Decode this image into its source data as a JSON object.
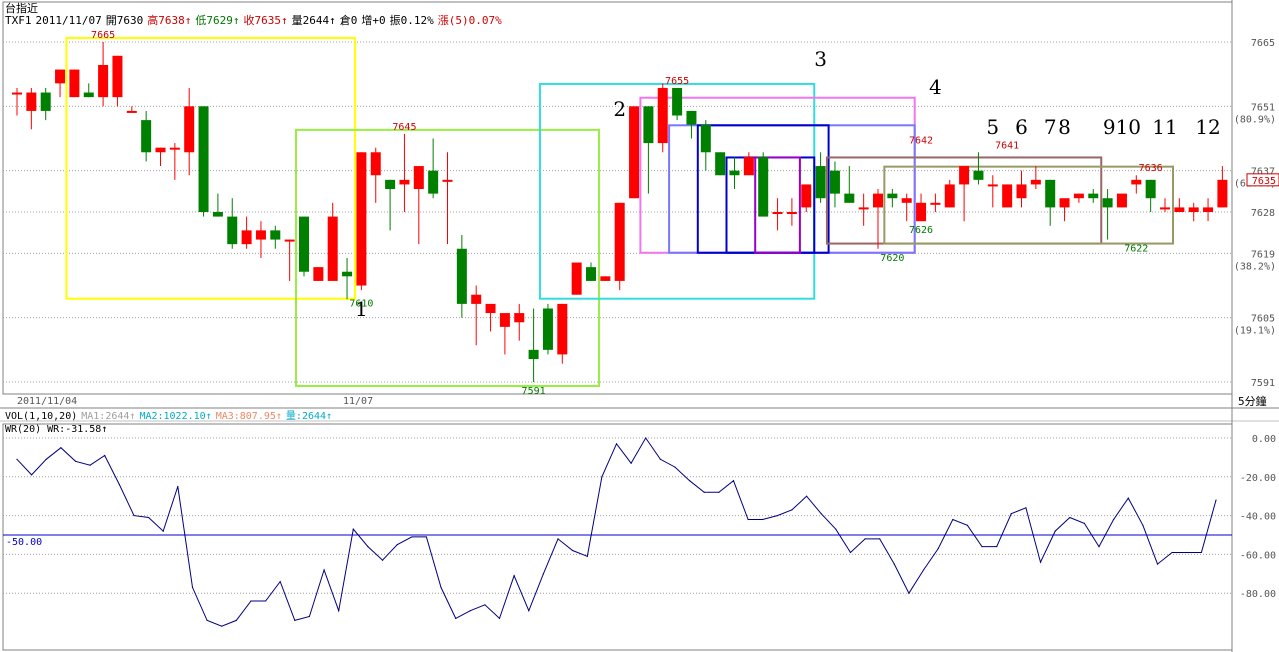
{
  "header": {
    "title": "台指近",
    "symbol": "TXF1",
    "date": "2011/11/07",
    "open": "開7630",
    "high": "高7638↑",
    "low": "低7629↑",
    "close": "收7635↑",
    "volume": "量2644↑",
    "position": "倉0",
    "change": "增+0",
    "amplitude": "振0.12%",
    "rise5": "漲(5)0.07%"
  },
  "vol_header": {
    "label": "VOL(1,10,20)",
    "ma1": "MA1:2644↑",
    "ma2": "MA2:1022.10↑",
    "ma3": "MA3:807.95↑",
    "qty": "量:2644↑"
  },
  "wr_header": "WR(20) WR:-31.58↑",
  "timeframe": "5分鐘",
  "date_labels": [
    "2011/11/04",
    "11/07"
  ],
  "colors": {
    "up": "#ff0000",
    "down": "#008000",
    "wr_line": "#00007f",
    "grid": "#a0a0a0"
  },
  "chart_data": [
    {
      "type": "candlestick",
      "title": "台指近 TXF1",
      "ylim": [
        7584,
        7672
      ],
      "y_ticks": [
        7591,
        7605,
        7619,
        7628,
        7637,
        7651,
        7665
      ],
      "y_tick_pct": [
        {
          "value": 7605,
          "label": "(19.1%)"
        },
        {
          "value": 7619,
          "label": "(38.2%)"
        },
        {
          "value": 7637,
          "label": "(61.8%)"
        },
        {
          "value": 7651,
          "label": "(80.9%)"
        }
      ],
      "last_price": 7635,
      "candles": [
        {
          "o": 7654,
          "h": 7655,
          "l": 7649,
          "c": 7654
        },
        {
          "o": 7650,
          "h": 7655,
          "l": 7646,
          "c": 7654
        },
        {
          "o": 7654,
          "h": 7655,
          "l": 7648,
          "c": 7650
        },
        {
          "o": 7656,
          "h": 7659,
          "l": 7653,
          "c": 7659
        },
        {
          "o": 7653,
          "h": 7659,
          "l": 7653,
          "c": 7659
        },
        {
          "o": 7654,
          "h": 7656,
          "l": 7653,
          "c": 7653
        },
        {
          "o": 7653,
          "h": 7665,
          "l": 7651,
          "c": 7660
        },
        {
          "o": 7653,
          "h": 7662,
          "l": 7651,
          "c": 7662
        },
        {
          "o": 7650,
          "h": 7651,
          "l": 7650,
          "c": 7650
        },
        {
          "o": 7648,
          "h": 7650,
          "l": 7639,
          "c": 7641
        },
        {
          "o": 7641,
          "h": 7642,
          "l": 7638,
          "c": 7642
        },
        {
          "o": 7642,
          "h": 7643,
          "l": 7635,
          "c": 7642
        },
        {
          "o": 7641,
          "h": 7655,
          "l": 7636,
          "c": 7651
        },
        {
          "o": 7651,
          "h": 7651,
          "l": 7627,
          "c": 7628
        },
        {
          "o": 7628,
          "h": 7632,
          "l": 7627,
          "c": 7627
        },
        {
          "o": 7627,
          "h": 7631,
          "l": 7620,
          "c": 7621
        },
        {
          "o": 7621,
          "h": 7627,
          "l": 7620,
          "c": 7624
        },
        {
          "o": 7622,
          "h": 7626,
          "l": 7618,
          "c": 7624
        },
        {
          "o": 7624,
          "h": 7625,
          "l": 7620,
          "c": 7622
        },
        {
          "o": 7622,
          "h": 7622,
          "l": 7613,
          "c": 7622
        },
        {
          "o": 7627,
          "h": 7627,
          "l": 7614,
          "c": 7615
        },
        {
          "o": 7613,
          "h": 7616,
          "l": 7613,
          "c": 7616
        },
        {
          "o": 7613,
          "h": 7630,
          "l": 7613,
          "c": 7627
        },
        {
          "o": 7615,
          "h": 7618,
          "l": 7609,
          "c": 7614
        },
        {
          "o": 7612,
          "h": 7641,
          "l": 7611,
          "c": 7641
        },
        {
          "o": 7636,
          "h": 7642,
          "l": 7630,
          "c": 7641
        },
        {
          "o": 7635,
          "h": 7635,
          "l": 7624,
          "c": 7633
        },
        {
          "o": 7634,
          "h": 7645,
          "l": 7628,
          "c": 7635
        },
        {
          "o": 7633,
          "h": 7635,
          "l": 7621,
          "c": 7638
        },
        {
          "o": 7637,
          "h": 7644,
          "l": 7631,
          "c": 7632
        },
        {
          "o": 7635,
          "h": 7641,
          "l": 7621,
          "c": 7635
        },
        {
          "o": 7620,
          "h": 7623,
          "l": 7605,
          "c": 7608
        },
        {
          "o": 7608,
          "h": 7612,
          "l": 7599,
          "c": 7610
        },
        {
          "o": 7606,
          "h": 7607,
          "l": 7602,
          "c": 7608
        },
        {
          "o": 7603,
          "h": 7604,
          "l": 7597,
          "c": 7606
        },
        {
          "o": 7604,
          "h": 7608,
          "l": 7600,
          "c": 7606
        },
        {
          "o": 7598,
          "h": 7607,
          "l": 7591,
          "c": 7596
        },
        {
          "o": 7607,
          "h": 7608,
          "l": 7597,
          "c": 7598
        },
        {
          "o": 7597,
          "h": 7608,
          "l": 7595,
          "c": 7608
        },
        {
          "o": 7610,
          "h": 7617,
          "l": 7610,
          "c": 7617
        },
        {
          "o": 7616,
          "h": 7617,
          "l": 7613,
          "c": 7613
        },
        {
          "o": 7613,
          "h": 7614,
          "l": 7613,
          "c": 7614
        },
        {
          "o": 7613,
          "h": 7630,
          "l": 7611,
          "c": 7630
        },
        {
          "o": 7631,
          "h": 7651,
          "l": 7631,
          "c": 7651
        },
        {
          "o": 7651,
          "h": 7651,
          "l": 7632,
          "c": 7643
        },
        {
          "o": 7643,
          "h": 7656,
          "l": 7641,
          "c": 7655
        },
        {
          "o": 7655,
          "h": 7655,
          "l": 7648,
          "c": 7649
        },
        {
          "o": 7650,
          "h": 7650,
          "l": 7644,
          "c": 7647
        },
        {
          "o": 7647,
          "h": 7648,
          "l": 7637,
          "c": 7641
        },
        {
          "o": 7641,
          "h": 7641,
          "l": 7636,
          "c": 7636
        },
        {
          "o": 7637,
          "h": 7640,
          "l": 7633,
          "c": 7636
        },
        {
          "o": 7636,
          "h": 7641,
          "l": 7636,
          "c": 7640
        },
        {
          "o": 7640,
          "h": 7641,
          "l": 7627,
          "c": 7627
        },
        {
          "o": 7628,
          "h": 7631,
          "l": 7624,
          "c": 7628
        },
        {
          "o": 7628,
          "h": 7631,
          "l": 7625,
          "c": 7628
        },
        {
          "o": 7629,
          "h": 7634,
          "l": 7628,
          "c": 7634
        },
        {
          "o": 7638,
          "h": 7641,
          "l": 7630,
          "c": 7631
        },
        {
          "o": 7637,
          "h": 7639,
          "l": 7629,
          "c": 7632
        },
        {
          "o": 7632,
          "h": 7638,
          "l": 7630,
          "c": 7630
        },
        {
          "o": 7629,
          "h": 7632,
          "l": 7625,
          "c": 7629
        },
        {
          "o": 7629,
          "h": 7633,
          "l": 7620,
          "c": 7632
        },
        {
          "o": 7632,
          "h": 7633,
          "l": 7629,
          "c": 7631
        },
        {
          "o": 7630,
          "h": 7632,
          "l": 7626,
          "c": 7631
        },
        {
          "o": 7626,
          "h": 7632,
          "l": 7626,
          "c": 7630
        },
        {
          "o": 7630,
          "h": 7632,
          "l": 7628,
          "c": 7630
        },
        {
          "o": 7629,
          "h": 7635,
          "l": 7629,
          "c": 7634
        },
        {
          "o": 7634,
          "h": 7638,
          "l": 7626,
          "c": 7638
        },
        {
          "o": 7637,
          "h": 7641,
          "l": 7634,
          "c": 7635
        },
        {
          "o": 7634,
          "h": 7636,
          "l": 7629,
          "c": 7634
        },
        {
          "o": 7629,
          "h": 7634,
          "l": 7629,
          "c": 7634
        },
        {
          "o": 7631,
          "h": 7637,
          "l": 7629,
          "c": 7634
        },
        {
          "o": 7634,
          "h": 7638,
          "l": 7633,
          "c": 7635
        },
        {
          "o": 7635,
          "h": 7635,
          "l": 7625,
          "c": 7629
        },
        {
          "o": 7629,
          "h": 7630,
          "l": 7626,
          "c": 7631
        },
        {
          "o": 7631,
          "h": 7632,
          "l": 7630,
          "c": 7632
        },
        {
          "o": 7632,
          "h": 7633,
          "l": 7630,
          "c": 7631
        },
        {
          "o": 7631,
          "h": 7633,
          "l": 7622,
          "c": 7629
        },
        {
          "o": 7629,
          "h": 7632,
          "l": 7629,
          "c": 7632
        },
        {
          "o": 7634,
          "h": 7636,
          "l": 7632,
          "c": 7635
        },
        {
          "o": 7635,
          "h": 7635,
          "l": 7628,
          "c": 7631
        },
        {
          "o": 7629,
          "h": 7631,
          "l": 7628,
          "c": 7629
        },
        {
          "o": 7628,
          "h": 7631,
          "l": 7628,
          "c": 7629
        },
        {
          "o": 7628,
          "h": 7630,
          "l": 7626,
          "c": 7629
        },
        {
          "o": 7628,
          "h": 7631,
          "l": 7626,
          "c": 7629
        },
        {
          "o": 7629,
          "h": 7638,
          "l": 7629,
          "c": 7635
        }
      ],
      "annotations": [
        {
          "label": "7665",
          "value": 7665,
          "bar": 6
        },
        {
          "label": "7645",
          "value": 7645,
          "bar": 27
        },
        {
          "label": "7610",
          "value": 7610,
          "bar": 24
        },
        {
          "label": "7591",
          "value": 7591,
          "bar": 36
        },
        {
          "label": "7655",
          "value": 7655,
          "bar": 46
        },
        {
          "label": "7642",
          "value": 7642,
          "bar": 63
        },
        {
          "label": "7641",
          "value": 7641,
          "bar": 69
        },
        {
          "label": "7636",
          "value": 7636,
          "bar": 79
        },
        {
          "label": "7626",
          "value": 7626,
          "bar": 63
        },
        {
          "label": "7620",
          "value": 7620,
          "bar": 61
        },
        {
          "label": "7622",
          "value": 7622,
          "bar": 78
        }
      ],
      "box_labels": [
        "1",
        "2",
        "3",
        "4",
        "5",
        "6",
        "7",
        "8",
        "910",
        "11",
        "12"
      ],
      "boxes": [
        {
          "color": "#ffff00",
          "bar_from": 4,
          "bar_to": 23,
          "top": 7665,
          "bottom": 7610
        },
        {
          "color": "#99ee44",
          "bar_from": 20,
          "bar_to": 40,
          "top": 7645,
          "bottom": 7591
        },
        {
          "color": "#33dddd",
          "bar_from": 37,
          "bar_to": 55,
          "top": 7655,
          "bottom": 7610
        },
        {
          "color": "#ee77ee",
          "bar_from": 44,
          "bar_to": 62,
          "top": 7652,
          "bottom": 7620
        },
        {
          "color": "#7777ff",
          "bar_from": 46,
          "bar_to": 62,
          "top": 7646,
          "bottom": 7620
        },
        {
          "color": "#0000cc",
          "bar_from": 48,
          "bar_to": 56,
          "top": 7646,
          "bottom": 7620
        },
        {
          "color": "#0000cc",
          "bar_from": 50,
          "bar_to": 55,
          "top": 7639,
          "bottom": 7620
        },
        {
          "color": "#9900cc",
          "bar_from": 52,
          "bar_to": 54,
          "top": 7639,
          "bottom": 7620
        },
        {
          "color": "#996666",
          "bar_from": 57,
          "bar_to": 75,
          "top": 7639,
          "bottom": 7622
        },
        {
          "color": "#999966",
          "bar_from": 61,
          "bar_to": 80,
          "top": 7637,
          "bottom": 7622
        }
      ],
      "xlabel": "",
      "ylabel": ""
    },
    {
      "type": "line",
      "title": "WR(20)",
      "ylim": [
        -100,
        5
      ],
      "y_ticks": [
        0,
        -20,
        -40,
        -60,
        -80
      ],
      "y_tick_labels": [
        "0.00",
        "-20.00",
        "-40.00",
        "-60.00",
        "-80.00"
      ],
      "reference_line": {
        "value": -50,
        "label": "-50.00"
      },
      "series": [
        {
          "name": "WR",
          "values": [
            -11,
            -19,
            -11,
            -5,
            -12,
            -14,
            -9,
            -24,
            -40,
            -41,
            -48,
            -25,
            -77,
            -94,
            -97,
            -94,
            -84,
            -84,
            -74,
            -94,
            -92,
            -68,
            -89,
            -47,
            -56,
            -63,
            -55,
            -51,
            -51,
            -77,
            -93,
            -89,
            -86,
            -93,
            -71,
            -89,
            -70,
            -52,
            -58,
            -61,
            -20,
            -3,
            -13,
            0,
            -11,
            -15,
            -22,
            -28,
            -28,
            -22,
            -42,
            -42,
            -40,
            -37,
            -30,
            -39,
            -47,
            -59,
            -52,
            -52,
            -65,
            -80,
            -68,
            -57,
            -42,
            -45,
            -56,
            -56,
            -39,
            -36,
            -64,
            -48,
            -41,
            -44,
            -56,
            -42,
            -31,
            -45,
            -65,
            -59,
            -59,
            -59,
            -32
          ]
        }
      ]
    }
  ]
}
